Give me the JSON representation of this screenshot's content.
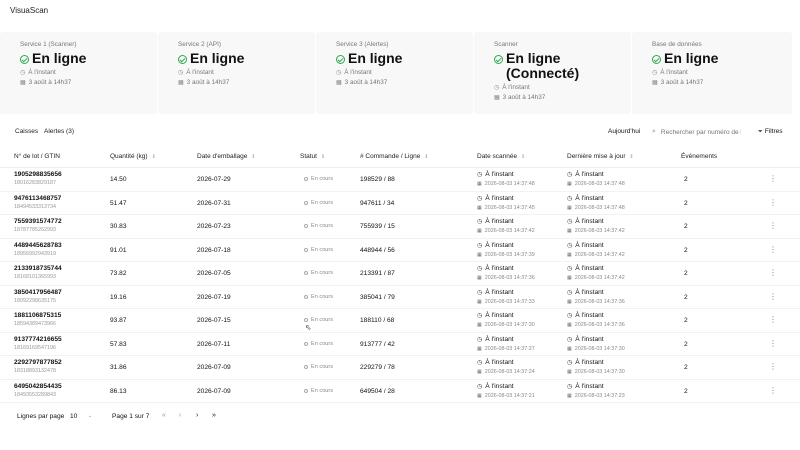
{
  "app": {
    "title": "VisuaScan"
  },
  "services": [
    {
      "label": "Service 1 (Scanner)",
      "status": "En ligne",
      "updated": "À l'instant",
      "date": "3 août à 14h37"
    },
    {
      "label": "Service 2 (API)",
      "status": "En ligne",
      "updated": "À l'instant",
      "date": "3 août à 14h37"
    },
    {
      "label": "Service 3 (Alertes)",
      "status": "En ligne",
      "updated": "À l'instant",
      "date": "3 août à 14h37"
    },
    {
      "label": "Scanner",
      "status": "En ligne (Connecté)",
      "updated": "À l'instant",
      "date": "3 août à 14h37"
    },
    {
      "label": "Base de données",
      "status": "En ligne",
      "updated": "À l'instant",
      "date": "3 août à 14h37"
    }
  ],
  "toolbar": {
    "tab_caisses": "Caisses",
    "tab_alertes": "Alertes (3)",
    "today": "Aujourd'hui",
    "search_placeholder": "Rechercher par numéro de lot",
    "filters": "Filtres"
  },
  "table": {
    "headers": {
      "lot": "N° de lot / GTIN",
      "qty": "Quantité (kg)",
      "date": "Date d'emballage",
      "statut": "Statut",
      "cmd": "# Commande / Ligne",
      "scan": "Date scannée",
      "upd": "Dernière mise à jour",
      "events": "Événements"
    },
    "rows": [
      {
        "lot": "1905298835656",
        "gtin": "18016283829187",
        "qty": "14.50",
        "date": "2026-07-29",
        "statut": "En cours",
        "cmd": "198529  /  88",
        "scan_rel": "À l'instant",
        "scan_abs": "2026-08-03 14:37:48",
        "upd_rel": "À l'instant",
        "upd_abs": "2026-08-03 14:37:48",
        "events": "2"
      },
      {
        "lot": "9476113468757",
        "gtin": "18494533313734",
        "qty": "51.47",
        "date": "2026-07-31",
        "statut": "En cours",
        "cmd": "947611  /  34",
        "scan_rel": "À l'instant",
        "scan_abs": "2026-08-03 14:37:45",
        "upd_rel": "À l'instant",
        "upd_abs": "2026-08-03 14:37:48",
        "events": "2"
      },
      {
        "lot": "7559391574772",
        "gtin": "18787785262993",
        "qty": "30.83",
        "date": "2026-07-23",
        "statut": "En cours",
        "cmd": "755939  /  15",
        "scan_rel": "À l'instant",
        "scan_abs": "2026-08-03 14:37:42",
        "upd_rel": "À l'instant",
        "upd_abs": "2026-08-03 14:37:42",
        "events": "2"
      },
      {
        "lot": "4489445628783",
        "gtin": "18956992943919",
        "qty": "91.01",
        "date": "2026-07-18",
        "statut": "En cours",
        "cmd": "448944  /  56",
        "scan_rel": "À l'instant",
        "scan_abs": "2026-08-03 14:37:39",
        "upd_rel": "À l'instant",
        "upd_abs": "2026-08-03 14:37:42",
        "events": "2"
      },
      {
        "lot": "2133918735744",
        "gtin": "18168101365993",
        "qty": "73.82",
        "date": "2026-07-05",
        "statut": "En cours",
        "cmd": "213391  /  87",
        "scan_rel": "À l'instant",
        "scan_abs": "2026-08-03 14:37:36",
        "upd_rel": "À l'instant",
        "upd_abs": "2026-08-03 14:37:42",
        "events": "2"
      },
      {
        "lot": "3850417956487",
        "gtin": "18092298635175",
        "qty": "19.16",
        "date": "2026-07-19",
        "statut": "En cours",
        "cmd": "385041  /  79",
        "scan_rel": "À l'instant",
        "scan_abs": "2026-08-03 14:37:33",
        "upd_rel": "À l'instant",
        "upd_abs": "2026-08-03 14:37:36",
        "events": "2"
      },
      {
        "lot": "1881106875315",
        "gtin": "18594389473966",
        "qty": "93.87",
        "date": "2026-07-15",
        "statut": "En cours",
        "cmd": "188110  /  68",
        "scan_rel": "À l'instant",
        "scan_abs": "2026-08-03 14:37:30",
        "upd_rel": "À l'instant",
        "upd_abs": "2026-08-03 14:37:36",
        "events": "2"
      },
      {
        "lot": "9137774216655",
        "gtin": "18169169547196",
        "qty": "57.83",
        "date": "2026-07-11",
        "statut": "En cours",
        "cmd": "913777  /  42",
        "scan_rel": "À l'instant",
        "scan_abs": "2026-08-03 14:37:27",
        "upd_rel": "À l'instant",
        "upd_abs": "2026-08-03 14:37:30",
        "events": "2"
      },
      {
        "lot": "2292797877852",
        "gtin": "18318893132478",
        "qty": "31.86",
        "date": "2026-07-09",
        "statut": "En cours",
        "cmd": "229279  /  78",
        "scan_rel": "À l'instant",
        "scan_abs": "2026-08-03 14:37:24",
        "upd_rel": "À l'instant",
        "upd_abs": "2026-08-03 14:37:30",
        "events": "2"
      },
      {
        "lot": "6495042854435",
        "gtin": "18493553289843",
        "qty": "86.13",
        "date": "2026-07-09",
        "statut": "En cours",
        "cmd": "649504  /  28",
        "scan_rel": "À l'instant",
        "scan_abs": "2026-08-03 14:37:21",
        "upd_rel": "À l'instant",
        "upd_abs": "2026-08-03 14:37:23",
        "events": "2"
      }
    ]
  },
  "pagination": {
    "rows_label": "Lignes par page",
    "rows_value": "10",
    "page_info": "Page 1 sur 7",
    "first": "«",
    "prev": "‹",
    "next": "›",
    "last": "»"
  },
  "colors": {
    "accent_green": "#2fa84f"
  },
  "icons": [
    "check-circle-icon",
    "clock-icon",
    "calendar-icon",
    "search-icon",
    "filter-icon",
    "sort-icon",
    "more-vertical-icon"
  ]
}
